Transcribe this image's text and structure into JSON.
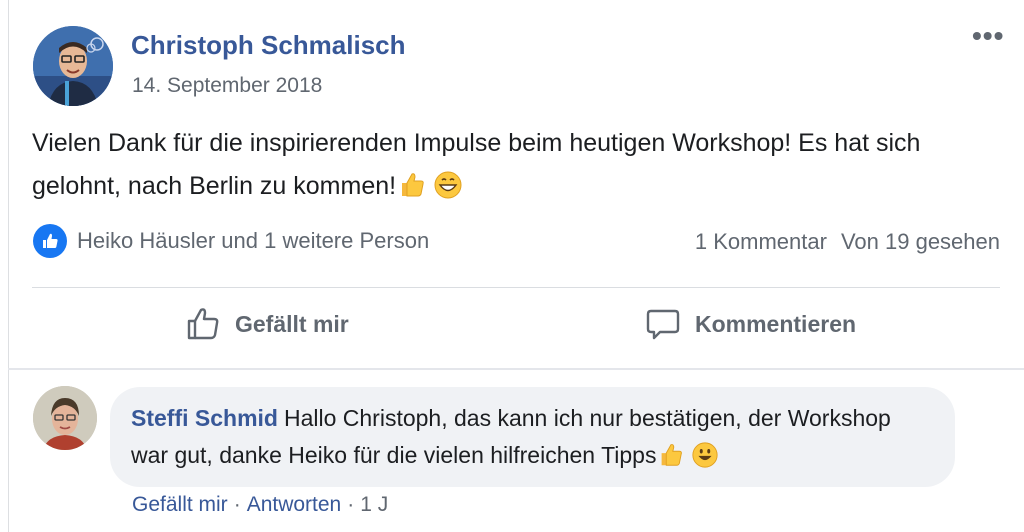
{
  "post": {
    "author": "Christoph Schmalisch",
    "date": "14. September 2018",
    "text": "Vielen Dank für die inspirierenden Impulse beim heutigen Workshop! Es hat sich gelohnt, nach Berlin zu kommen!",
    "more_label": "•••",
    "reactions_label": "Heiko Häusler und 1 weitere Person",
    "comments_count": "1 Kommentar",
    "views": "Von 19 gesehen"
  },
  "actions": {
    "like_label": "Gefällt mir",
    "comment_label": "Kommentieren"
  },
  "comment": {
    "author": "Steffi Schmid",
    "text": "Hallo Christoph, das kann ich nur bestätigen, der Workshop war gut, danke Heiko für die vielen hilfreichen Tipps",
    "like_label": "Gefällt mir",
    "reply_label": "Antworten",
    "time": "1 J",
    "separator": "·"
  },
  "colors": {
    "link": "#385898",
    "meta": "#606770",
    "like_blue": "#1877f2",
    "bubble": "#f0f2f5"
  },
  "icons": [
    "more-options-icon",
    "like-badge-icon",
    "thumbs-up-emoji",
    "grin-emoji",
    "like-outline-icon",
    "comment-bubble-icon",
    "smile-emoji"
  ]
}
